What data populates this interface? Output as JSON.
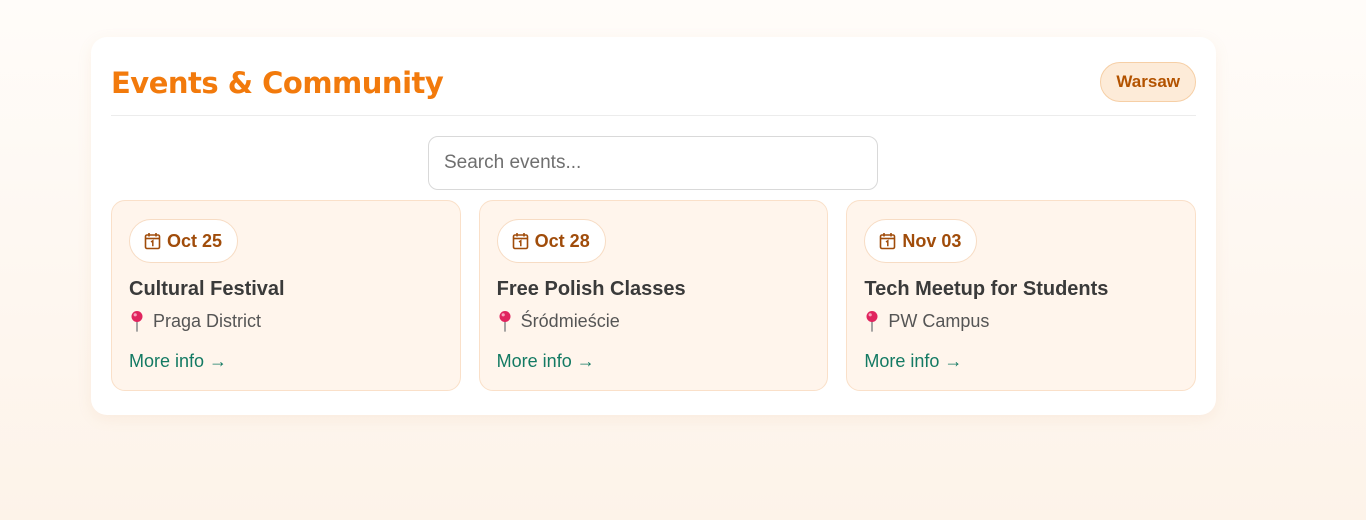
{
  "header": {
    "title": "Events & Community",
    "city": "Warsaw"
  },
  "search": {
    "placeholder": "Search events...",
    "value": ""
  },
  "events": [
    {
      "date": "Oct 25",
      "title": "Cultural Festival",
      "location": "Praga District",
      "link": "More info →"
    },
    {
      "date": "Oct 28",
      "title": "Free Polish Classes",
      "location": "Śródmieście",
      "link": "More info →"
    },
    {
      "date": "Nov 03",
      "title": "Tech Meetup for Students",
      "location": "PW Campus",
      "link": "More info →"
    }
  ],
  "icons": {
    "date": "calendar-icon",
    "location": "round-pushpin-icon"
  },
  "colors": {
    "accent": "#f27a0c",
    "badge_bg": "#fdebd8",
    "card_bg": "#fff5ec",
    "date_text": "#a04c0a",
    "link": "#137a63",
    "pin": "#e0245e"
  }
}
